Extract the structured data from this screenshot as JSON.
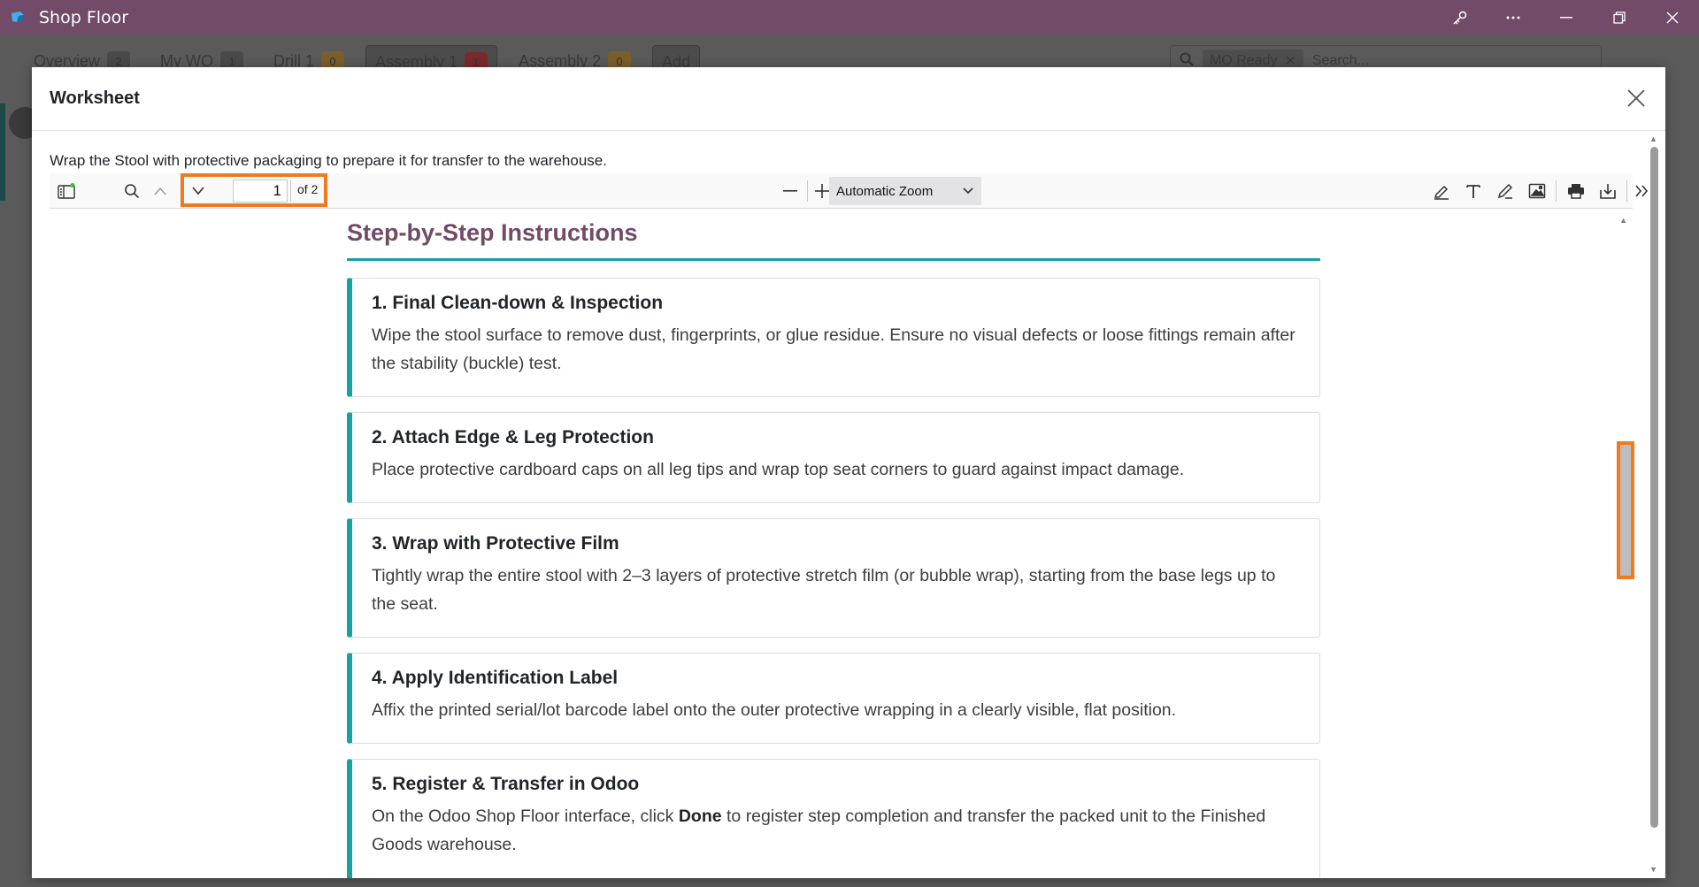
{
  "window": {
    "title": "Shop Floor",
    "icons": [
      "odoo-app-icon",
      "key-icon",
      "more-icon",
      "restore-icon",
      "close-icon"
    ]
  },
  "background": {
    "tabs": [
      {
        "label": "Overview",
        "count": "2"
      },
      {
        "label": "My WO",
        "count": "1"
      },
      {
        "label": "Drill 1",
        "count": "0"
      },
      {
        "label": "Assembly 1",
        "count": "1"
      },
      {
        "label": "Assembly 2",
        "count": "0"
      },
      {
        "label": "Add",
        "count": ""
      }
    ],
    "search_chip": "MO Ready",
    "search_placeholder": "Search..."
  },
  "modal": {
    "title": "Worksheet",
    "description": "Wrap the Stool with protective packaging to prepare it for transfer to the warehouse."
  },
  "viewer": {
    "page_number": "1",
    "page_count_label": "of 2",
    "zoom_label": "Automatic Zoom",
    "toolbar_icons": [
      "sidebar-toggle-icon",
      "search-icon",
      "previous-page-icon",
      "next-page-icon",
      "zoom-out-icon",
      "zoom-in-icon",
      "highlight-icon",
      "text-icon",
      "draw-icon",
      "image-icon",
      "print-icon",
      "download-icon",
      "tools-icon"
    ]
  },
  "document": {
    "heading": "Step-by-Step Instructions",
    "steps": [
      {
        "title": "1. Final Clean-down & Inspection",
        "body": "Wipe the stool surface to remove dust, fingerprints, or glue residue. Ensure no visual defects or loose fittings remain after the stability (buckle) test."
      },
      {
        "title": "2. Attach Edge & Leg Protection",
        "body": "Place protective cardboard caps on all leg tips and wrap top seat corners to guard against impact damage."
      },
      {
        "title": "3. Wrap with Protective Film",
        "body": "Tightly wrap the entire stool with 2–3 layers of protective stretch film (or bubble wrap), starting from the base legs up to the seat."
      },
      {
        "title": "4. Apply Identification Label",
        "body": "Affix the printed serial/lot barcode label onto the outer protective wrapping in a clearly visible, flat position."
      },
      {
        "title": "5. Register & Transfer in Odoo",
        "body_pre": "On the Odoo Shop Floor interface, click ",
        "body_bold": "Done",
        "body_post": " to register step completion and transfer the packed unit to the Finished Goods warehouse."
      }
    ]
  },
  "colors": {
    "titlebar": "#714b67",
    "accent_teal": "#17a2a2",
    "heading_purple": "#714b67",
    "highlight_orange": "#f07a1e"
  }
}
